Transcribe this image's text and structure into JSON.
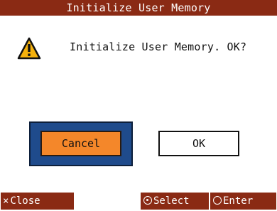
{
  "dialog": {
    "title": "Initialize User Memory",
    "icon": "warning-icon",
    "message": "Initialize User Memory. OK?",
    "cancel_label": "Cancel",
    "ok_label": "OK",
    "selected_button": "Cancel"
  },
  "footer": {
    "close": {
      "icon": "close-x-icon",
      "glyph": "×",
      "label": "Close"
    },
    "select": {
      "icon": "select-dial-icon",
      "label": "Select"
    },
    "enter": {
      "icon": "enter-circle-icon",
      "label": "Enter"
    }
  },
  "colors": {
    "titlebar": "#8a2a14",
    "selection_frame": "#1f4b8c",
    "selected_button": "#f4872a",
    "warning_yellow": "#f5b10c"
  }
}
